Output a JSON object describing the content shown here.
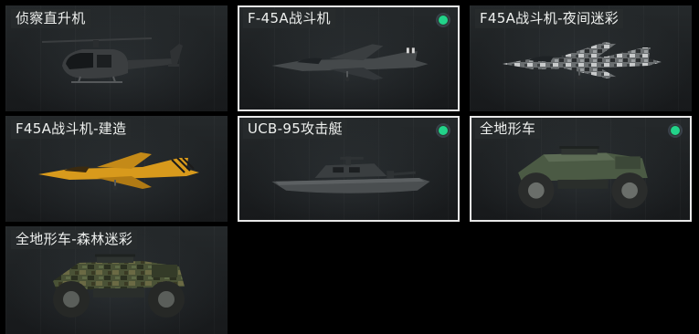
{
  "vehicles": [
    {
      "label": "侦察直升机",
      "icon": "helicopter-icon",
      "equipped": false
    },
    {
      "label": "F-45A战斗机",
      "icon": "fighter-jet-icon",
      "equipped": true
    },
    {
      "label": "F45A战斗机-夜间迷彩",
      "icon": "fighter-jet-camo-icon",
      "equipped": false
    },
    {
      "label": "F45A战斗机-建造",
      "icon": "fighter-jet-yellow-icon",
      "equipped": false
    },
    {
      "label": "UCB-95攻击艇",
      "icon": "attack-boat-icon",
      "equipped": true
    },
    {
      "label": "全地形车",
      "icon": "atv-icon",
      "equipped": true
    },
    {
      "label": "全地形车-森林迷彩",
      "icon": "atv-camo-icon",
      "equipped": false
    }
  ],
  "colors": {
    "equipped_indicator": "#22d38a",
    "selected_border": "#e8e8e8",
    "card_bg": "#1e2123"
  }
}
